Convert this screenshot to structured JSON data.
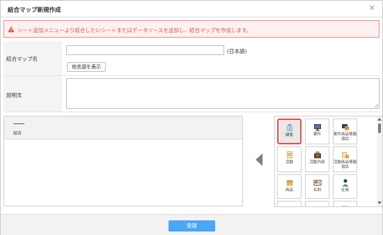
{
  "dialog": {
    "title": "結合マップ新規作成",
    "close_icon": "close-icon"
  },
  "alert": {
    "icon": "warning-icon",
    "text": "シート追加メニューより結合したいシートまたはデータソースを追加し、結合マップを作成します。",
    "color": "#d9534f"
  },
  "form": {
    "name_label": "結合マップ名",
    "name_value": "",
    "lang_label": "(日本語)",
    "alt_button_label": "他言語を表示",
    "description_label": "説明文",
    "description_value": ""
  },
  "join_panel": {
    "label": "結合"
  },
  "palette": {
    "tiles": [
      {
        "label": "顧客",
        "icon": "customer-building-icon",
        "selected": true
      },
      {
        "label": "案件",
        "icon": "deal-monitor-icon",
        "selected": false
      },
      {
        "label": "案件商品情報項目",
        "icon": "deal-product-icon",
        "selected": false
      },
      {
        "label": "活動",
        "icon": "activity-notepad-icon",
        "selected": false
      },
      {
        "label": "活動内容",
        "icon": "briefcase-icon",
        "selected": false
      },
      {
        "label": "活動商品情報項目",
        "icon": "activity-product-icon",
        "selected": false
      },
      {
        "label": "商品",
        "icon": "product-box-icon",
        "selected": false
      },
      {
        "label": "名刺",
        "icon": "business-card-icon",
        "selected": false
      },
      {
        "label": "社員",
        "icon": "employee-icon",
        "selected": false
      },
      {
        "label": "",
        "icon": "group-icon",
        "selected": false
      },
      {
        "label": "",
        "icon": "team-icon",
        "selected": false
      },
      {
        "label": "",
        "icon": "calendar-icon",
        "selected": false
      }
    ]
  },
  "footer": {
    "register_label": "登録",
    "accent": "#4ba6f5"
  }
}
